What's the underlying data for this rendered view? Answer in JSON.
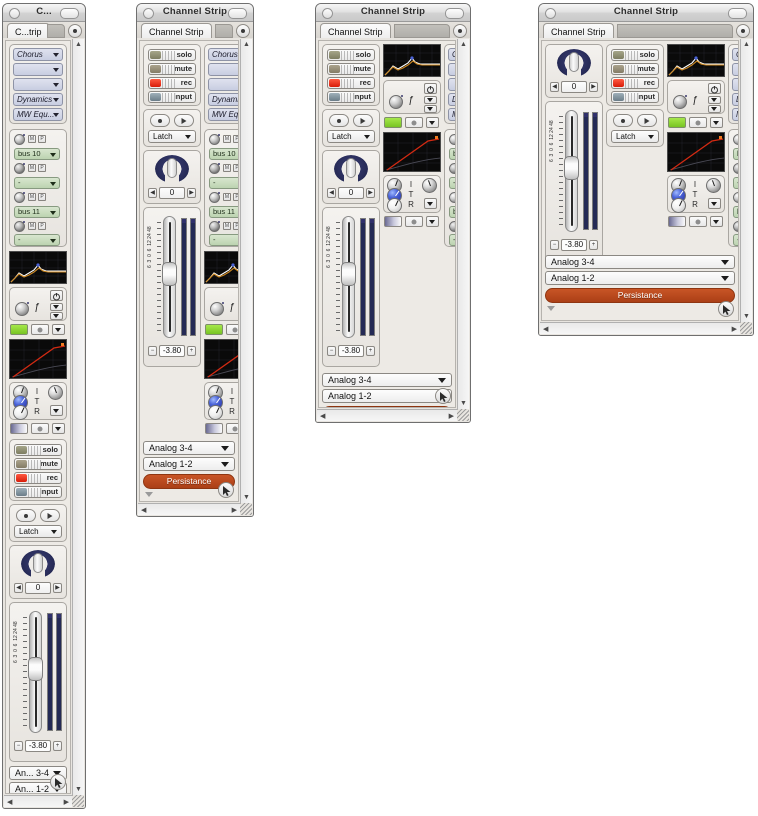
{
  "app": {
    "title": "Channel Strip",
    "tab_label": "Channel Strip",
    "window_titles": [
      "C...",
      "Channel Strip",
      "Channel Strip",
      "Channel Strip"
    ],
    "tab_labels": [
      "C...trip",
      "Channel Strip",
      "Channel Strip",
      "Channel Strip"
    ]
  },
  "plugin_slots": [
    {
      "label": "Chorus"
    },
    {
      "label": ""
    },
    {
      "label": ""
    },
    {
      "label": "Dynamics"
    },
    {
      "label": "MW Equ..."
    }
  ],
  "sends": [
    {
      "bus": "bus 10",
      "mute": "M",
      "pre": "P"
    },
    {
      "bus": "-",
      "mute": "M",
      "pre": "P"
    },
    {
      "bus": "bus 11",
      "mute": "M",
      "pre": "P"
    },
    {
      "bus": "-",
      "mute": "M",
      "pre": "P"
    }
  ],
  "channel_buttons": [
    {
      "label": "solo",
      "led_color": "#8a8a6e"
    },
    {
      "label": "mute",
      "led_color": "#8e8670"
    },
    {
      "label": "rec",
      "led_color": "#ee2a18"
    },
    {
      "label": "input",
      "led_color": "#7d8c95"
    }
  ],
  "automation": {
    "record_icon": "record-dot-icon",
    "play_icon": "play-triangle-icon",
    "mode": "Latch"
  },
  "pan": {
    "value": "0",
    "dec_label": "◀",
    "inc_label": "▶"
  },
  "fader": {
    "value": "-3.80",
    "dec_label": "−",
    "inc_label": "+",
    "scale_labels": [
      "6",
      "3",
      "0",
      "6",
      "12",
      "24",
      "48"
    ]
  },
  "eq": {
    "power_icon": "power-icon",
    "freq_icon": "f-italic-icon",
    "up_caret": "caret-down-icon",
    "down_caret": "caret-down-icon",
    "led_on_color": "#8fd836"
  },
  "surround": {
    "labels": [
      "I",
      "T",
      "R"
    ]
  },
  "outputs": [
    {
      "label": "Analog 3-4"
    },
    {
      "label": "Analog 1-2"
    }
  ],
  "outputs_small": [
    {
      "label": "An... 3-4"
    },
    {
      "label": "An... 1-2"
    }
  ],
  "persistence": {
    "label": "Persistance"
  },
  "scroll": {
    "up_arrow": "▲",
    "down_arrow": "▼",
    "left_arrow": "◀",
    "right_arrow": "▶"
  },
  "colors": {
    "accent_orange": "#bc4a1e",
    "slot_blue": "#c8cde1",
    "send_green": "#bcd3b0",
    "meter_navy": "#242a55",
    "knob_navy": "#2b2f5e",
    "led_green": "#8fd836",
    "rec_red": "#ee2a18"
  }
}
